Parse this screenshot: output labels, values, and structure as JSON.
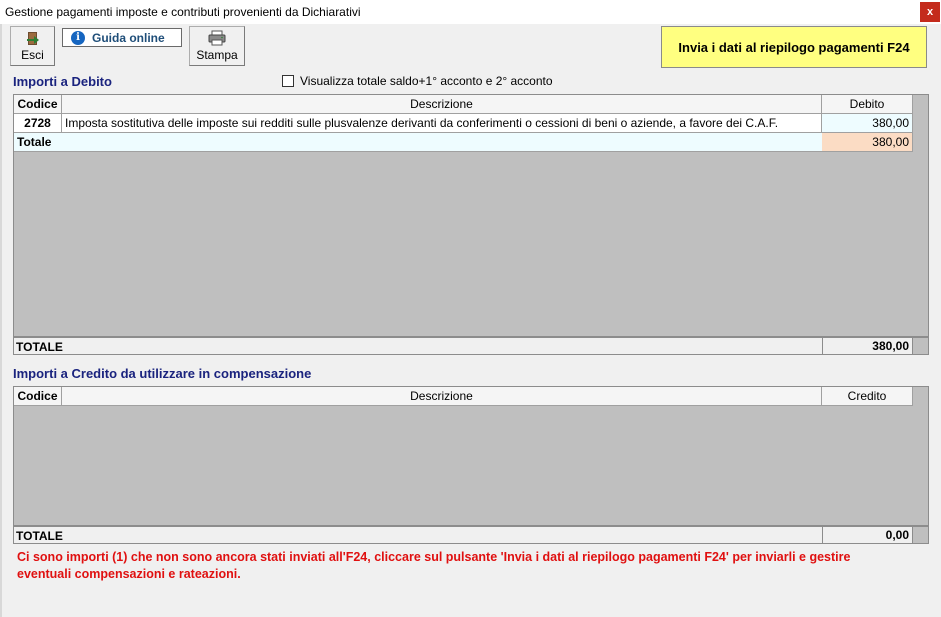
{
  "window": {
    "title": "Gestione pagamenti imposte e contributi provenienti da Dichiarativi",
    "close_label": "x"
  },
  "toolbar": {
    "esci_label": "Esci",
    "guida_label": "Guida online",
    "stampa_label": "Stampa",
    "invia_label": "Invia i dati al riepilogo pagamenti F24"
  },
  "debito": {
    "section_title": "Importi a Debito",
    "checkbox_label": "Visualizza totale saldo+1° acconto e 2° acconto",
    "checkbox_checked": false,
    "columns": [
      "Codice",
      "Descrizione",
      "Debito"
    ],
    "rows": [
      {
        "codice": "2728",
        "descrizione": "Imposta sostitutiva delle imposte sui redditi sulle plusvalenze derivanti da conferimenti o cessioni di beni o aziende, a favore dei C.A.F.",
        "importo": "380,00"
      }
    ],
    "subtotal_label": "Totale",
    "subtotal_value": "380,00",
    "total_label": "TOTALE",
    "total_value": "380,00"
  },
  "credito": {
    "section_title": "Importi a Credito da utilizzare in compensazione",
    "columns": [
      "Codice",
      "Descrizione",
      "Credito"
    ],
    "total_label": "TOTALE",
    "total_value": "0,00"
  },
  "warning": {
    "line1": "Ci sono importi (1) che non sono ancora stati inviati all'F24, cliccare sul pulsante 'Invia i dati al riepilogo pagamenti F24' per inviarli e gestire",
    "line2": "eventuali compensazioni e rateazioni."
  },
  "colors": {
    "invia_button": "#ffff80",
    "section_title": "#1a237e",
    "warning_text": "#e01010",
    "grid_background": "#bfbfbf",
    "debit_total_highlight": "#fbdcc4"
  },
  "icons": {
    "esci": "exit-door-icon",
    "guida": "info-icon",
    "stampa": "printer-icon",
    "close": "close-icon"
  }
}
